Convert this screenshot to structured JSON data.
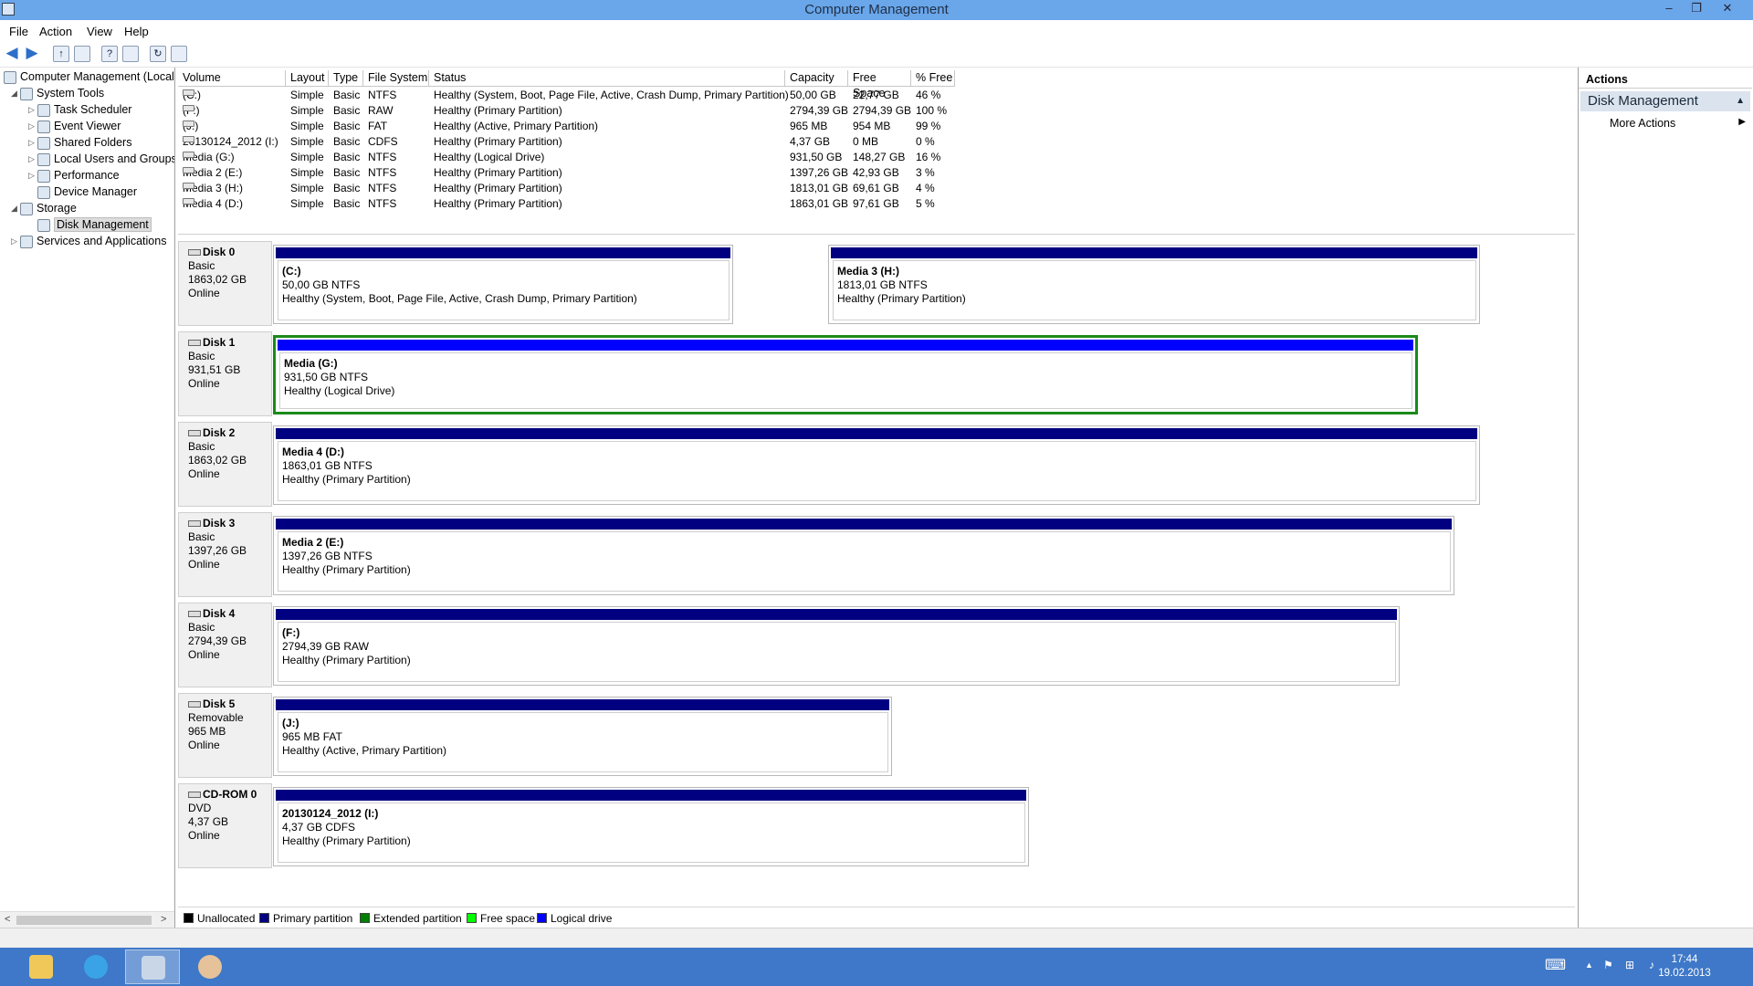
{
  "window": {
    "title": "Computer Management",
    "minimize": "–",
    "restore": "❐",
    "close": "✕"
  },
  "menu": [
    "File",
    "Action",
    "View",
    "Help"
  ],
  "toolbar": {
    "back": "◀",
    "forward": "▶",
    "up": "↑",
    "help": "?",
    "refresh": "↻"
  },
  "tree": {
    "root": "Computer Management (Local",
    "system_tools": "System Tools",
    "task_scheduler": "Task Scheduler",
    "event_viewer": "Event Viewer",
    "shared_folders": "Shared Folders",
    "local_users": "Local Users and Groups",
    "performance": "Performance",
    "device_manager": "Device Manager",
    "storage": "Storage",
    "disk_management": "Disk Management",
    "services": "Services and Applications",
    "expanded_glyph": "◢",
    "collapsed_glyph": "▷",
    "scroll_left": "<",
    "scroll_right": ">"
  },
  "volumes": {
    "headers": [
      "Volume",
      "Layout",
      "Type",
      "File System",
      "Status",
      "Capacity",
      "Free Space",
      "% Free"
    ],
    "rows": [
      [
        "(C:)",
        "Simple",
        "Basic",
        "NTFS",
        "Healthy (System, Boot, Page File, Active, Crash Dump, Primary Partition)",
        "50,00 GB",
        "22,77 GB",
        "46 %"
      ],
      [
        "(F:)",
        "Simple",
        "Basic",
        "RAW",
        "Healthy (Primary Partition)",
        "2794,39 GB",
        "2794,39 GB",
        "100 %"
      ],
      [
        "(J:)",
        "Simple",
        "Basic",
        "FAT",
        "Healthy (Active, Primary Partition)",
        "965 MB",
        "954 MB",
        "99 %"
      ],
      [
        "20130124_2012 (I:)",
        "Simple",
        "Basic",
        "CDFS",
        "Healthy (Primary Partition)",
        "4,37 GB",
        "0 MB",
        "0 %"
      ],
      [
        "Media (G:)",
        "Simple",
        "Basic",
        "NTFS",
        "Healthy (Logical Drive)",
        "931,50 GB",
        "148,27 GB",
        "16 %"
      ],
      [
        "Media 2 (E:)",
        "Simple",
        "Basic",
        "NTFS",
        "Healthy (Primary Partition)",
        "1397,26 GB",
        "42,93 GB",
        "3 %"
      ],
      [
        "Media 3 (H:)",
        "Simple",
        "Basic",
        "NTFS",
        "Healthy (Primary Partition)",
        "1813,01 GB",
        "69,61 GB",
        "4 %"
      ],
      [
        "Media 4 (D:)",
        "Simple",
        "Basic",
        "NTFS",
        "Healthy (Primary Partition)",
        "1863,01 GB",
        "97,61 GB",
        "5 %"
      ]
    ]
  },
  "disks": [
    {
      "name": "Disk 0",
      "type": "Basic",
      "size": "1863,02 GB",
      "state": "Online",
      "partitions": [
        {
          "name": "(C:)",
          "size": "50,00 GB NTFS",
          "status": "Healthy (System, Boot, Page File, Active, Crash Dump, Primary Partition)",
          "kind": "primary"
        },
        {
          "name": "Media 3  (H:)",
          "size": "1813,01 GB NTFS",
          "status": "Healthy (Primary Partition)",
          "kind": "primary"
        }
      ]
    },
    {
      "name": "Disk 1",
      "type": "Basic",
      "size": "931,51 GB",
      "state": "Online",
      "partitions": [
        {
          "name": "Media  (G:)",
          "size": "931,50 GB NTFS",
          "status": "Healthy (Logical Drive)",
          "kind": "logical"
        }
      ]
    },
    {
      "name": "Disk 2",
      "type": "Basic",
      "size": "1863,02 GB",
      "state": "Online",
      "partitions": [
        {
          "name": "Media 4  (D:)",
          "size": "1863,01 GB NTFS",
          "status": "Healthy (Primary Partition)",
          "kind": "primary"
        }
      ]
    },
    {
      "name": "Disk 3",
      "type": "Basic",
      "size": "1397,26 GB",
      "state": "Online",
      "partitions": [
        {
          "name": "Media 2  (E:)",
          "size": "1397,26 GB NTFS",
          "status": "Healthy (Primary Partition)",
          "kind": "primary"
        }
      ]
    },
    {
      "name": "Disk 4",
      "type": "Basic",
      "size": "2794,39 GB",
      "state": "Online",
      "partitions": [
        {
          "name": "(F:)",
          "size": "2794,39 GB RAW",
          "status": "Healthy (Primary Partition)",
          "kind": "primary"
        }
      ]
    },
    {
      "name": "Disk 5",
      "type": "Removable",
      "size": "965 MB",
      "state": "Online",
      "partitions": [
        {
          "name": "(J:)",
          "size": "965 MB FAT",
          "status": "Healthy (Active, Primary Partition)",
          "kind": "primary"
        }
      ]
    },
    {
      "name": "CD-ROM 0",
      "type": "DVD",
      "size": "4,37 GB",
      "state": "Online",
      "partitions": [
        {
          "name": "20130124_2012  (I:)",
          "size": "4,37 GB CDFS",
          "status": "Healthy (Primary Partition)",
          "kind": "primary"
        }
      ]
    }
  ],
  "legend": [
    {
      "label": "Unallocated",
      "color": "#000000"
    },
    {
      "label": "Primary partition",
      "color": "#000080"
    },
    {
      "label": "Extended partition",
      "color": "#008000"
    },
    {
      "label": "Free space",
      "color": "#00ff00"
    },
    {
      "label": "Logical drive",
      "color": "#0000ff"
    }
  ],
  "actions": {
    "header": "Actions",
    "section": "Disk Management",
    "section_glyph": "▲",
    "more": "More Actions",
    "more_glyph": "▶"
  },
  "taskbar": {
    "time": "17:44",
    "date": "19.02.2013",
    "tray_up": "▲",
    "keyboard_glyph": "⌨",
    "flag_glyph": "⚑",
    "network_glyph": "⊞",
    "volume_glyph": "♪"
  },
  "colors": {
    "primary": "#000080",
    "logical": "#0000ff",
    "selected_border": "#1a8a1a",
    "titlebar": "#6aa6ea",
    "taskbar": "#3f78c8"
  }
}
